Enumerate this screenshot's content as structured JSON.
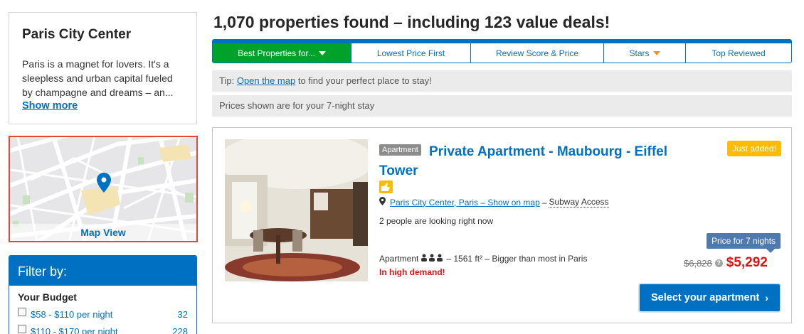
{
  "city": {
    "title": "Paris City Center",
    "description": "Paris is a magnet for lovers. It's a sleepless and urban capital fueled by champagne and dreams – an...",
    "show_more": "Show more"
  },
  "map": {
    "label": "Map View",
    "pin_icon": "map-pin-icon"
  },
  "filter": {
    "header": "Filter by:",
    "budget_title": "Your Budget",
    "items": [
      {
        "label": "$58 - $110 per night",
        "count": "32"
      },
      {
        "label": "$110 - $170 per night",
        "count": "228"
      }
    ]
  },
  "results": {
    "title": "1,070 properties found – including 123 value deals!",
    "sort_tabs": [
      {
        "label": "Best Properties for..."
      },
      {
        "label": "Lowest Price First"
      },
      {
        "label": "Review Score & Price"
      },
      {
        "label": "Stars"
      },
      {
        "label": "Top Reviewed"
      }
    ],
    "tip_prefix": "Tip:",
    "tip_link": "Open the map",
    "tip_suffix": "to find your perfect place to stay!",
    "price_note": "Prices shown are for your 7-night stay"
  },
  "property": {
    "type_badge": "Apartment",
    "title": "Private Apartment - Maubourg - Eiffel Tower",
    "location_link": "Paris City Center, Paris – Show on map",
    "location_sep": "–",
    "subway": "Subway Access",
    "looking": "2 people are looking right now",
    "room_type": "Apartment",
    "room_details": "– 1561 ft² – Bigger than most in Paris",
    "demand": "In high demand!",
    "just_added": "Just added!",
    "price_tip": "Price for 7 nights",
    "old_price": "$6,828",
    "new_price": "$5,292",
    "select_button": "Select your apartment"
  },
  "colors": {
    "brand_blue": "#0071c2",
    "active_green": "#00a22a",
    "price_red": "#e21111",
    "badge_yellow": "#febb02"
  }
}
